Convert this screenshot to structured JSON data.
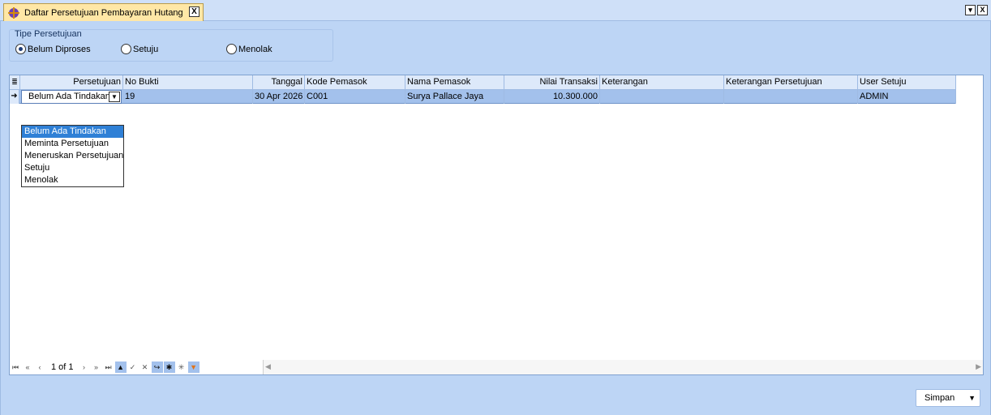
{
  "tab": {
    "title": "Daftar Persetujuan Pembayaran Hutang",
    "close_label": "X"
  },
  "window_controls": {
    "dropdown_label": "▾",
    "close_label": "X"
  },
  "approval_type": {
    "group_title": "Tipe Persetujuan",
    "options": [
      {
        "label": "Belum Diproses",
        "selected": true
      },
      {
        "label": "Setuju",
        "selected": false
      },
      {
        "label": "Menolak",
        "selected": false
      }
    ]
  },
  "grid": {
    "columns": [
      "Persetujuan",
      "No Bukti",
      "Tanggal",
      "Kode Pemasok",
      "Nama Pemasok",
      "Nilai Transaksi",
      "Keterangan",
      "Keterangan Persetujuan",
      "User Setuju"
    ],
    "rows": [
      {
        "persetujuan": "Belum Ada Tindakan",
        "no_bukti": "19",
        "tanggal": "30 Apr 2026",
        "kode_pemasok": "C001",
        "nama_pemasok": "Surya Pallace Jaya",
        "nilai_transaksi": "10.300.000",
        "keterangan": "",
        "keterangan_persetujuan": "",
        "user_setuju": "ADMIN"
      }
    ]
  },
  "dropdown": {
    "options": [
      "Belum Ada Tindakan",
      "Meminta Persetujuan",
      "Meneruskan Persetujuan",
      "Setuju",
      "Menolak"
    ],
    "selected": "Belum Ada Tindakan"
  },
  "navigator": {
    "page_text": "1 of 1"
  },
  "save_button": {
    "label": "Simpan"
  },
  "colors": {
    "tab_active": "#ffe7a6",
    "row_selected": "#a3c1ec",
    "dropdown_selected": "#2f80d6",
    "panel_bg": "#bdd5f5"
  }
}
